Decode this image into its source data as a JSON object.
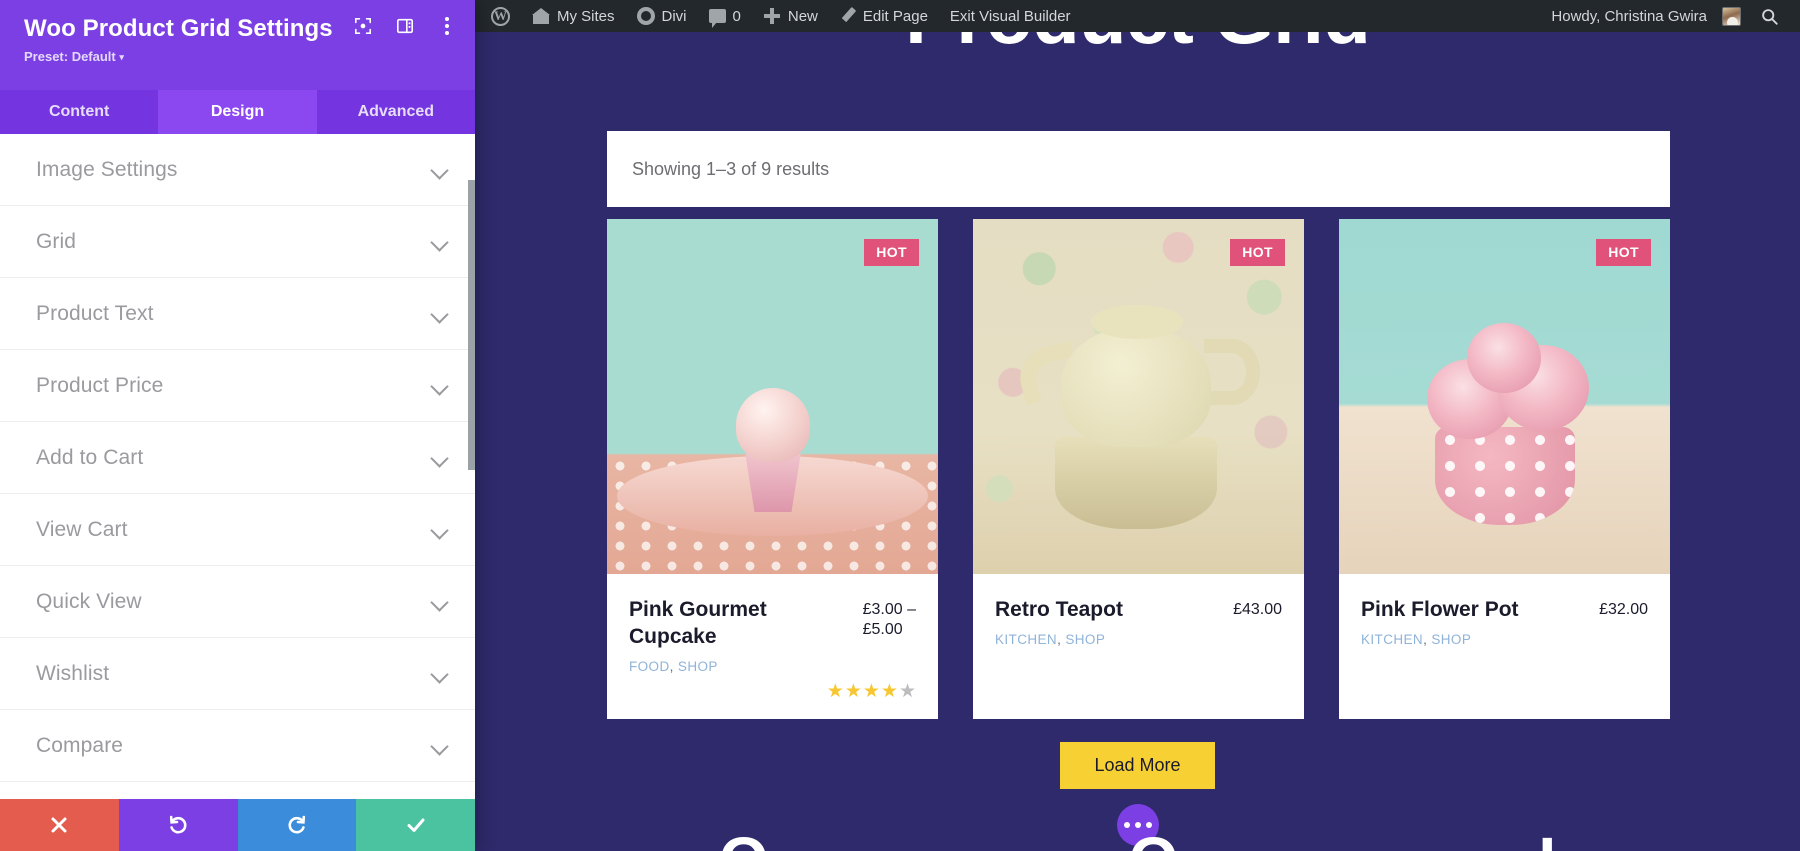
{
  "adminbar": {
    "items": [
      {
        "name": "wp-logo",
        "label": ""
      },
      {
        "name": "my-sites",
        "label": "My Sites"
      },
      {
        "name": "divi",
        "label": "Divi"
      },
      {
        "name": "comments",
        "label": "0"
      },
      {
        "name": "new",
        "label": "New"
      },
      {
        "name": "edit-page",
        "label": "Edit Page"
      },
      {
        "name": "exit-visual-builder",
        "label": "Exit Visual Builder"
      }
    ],
    "howdy": "Howdy, Christina Gwira",
    "search_icon": "search-icon"
  },
  "settings_panel": {
    "title": "Woo Product Grid Settings",
    "preset_label": "Preset: Default",
    "preset_caret": "▾",
    "header_icons": [
      {
        "name": "focus-target-icon"
      },
      {
        "name": "panel-layout-icon"
      },
      {
        "name": "more-options-icon"
      }
    ],
    "tabs": [
      {
        "label": "Content",
        "active": false
      },
      {
        "label": "Design",
        "active": true
      },
      {
        "label": "Advanced",
        "active": false
      }
    ],
    "sections": [
      {
        "label": "Image Settings"
      },
      {
        "label": "Grid"
      },
      {
        "label": "Product Text"
      },
      {
        "label": "Product Price"
      },
      {
        "label": "Add to Cart"
      },
      {
        "label": "View Cart"
      },
      {
        "label": "Quick View"
      },
      {
        "label": "Wishlist"
      },
      {
        "label": "Compare"
      }
    ],
    "footer_buttons": [
      {
        "name": "discard-changes-button",
        "icon": "close-icon",
        "color": "#e35c4d"
      },
      {
        "name": "undo-button",
        "icon": "undo-icon",
        "color": "#7b3fe4"
      },
      {
        "name": "redo-button",
        "icon": "redo-icon",
        "color": "#3b8ddc"
      },
      {
        "name": "save-changes-button",
        "icon": "check-icon",
        "color": "#4bc2a0"
      }
    ]
  },
  "canvas": {
    "page_title": "Product Grid",
    "results_text": "Showing 1–3 of 9 results",
    "background_color": "#2e2a6b",
    "badge_color": "#e0527a",
    "load_more_color": "#f7d033",
    "load_more_label": "Load More",
    "products": [
      {
        "badge": "HOT",
        "title": "Pink Gourmet Cupcake",
        "price": "£3.00 –\n£5.00",
        "categories": [
          "FOOD",
          "SHOP"
        ],
        "rating": 4,
        "max_rating": 5,
        "image": "cupcake-photo"
      },
      {
        "badge": "HOT",
        "title": "Retro Teapot",
        "price": "£43.00",
        "categories": [
          "KITCHEN",
          "SHOP"
        ],
        "rating": 0,
        "max_rating": 5,
        "image": "teapot-photo"
      },
      {
        "badge": "HOT",
        "title": "Pink Flower Pot",
        "price": "£32.00",
        "categories": [
          "KITCHEN",
          "SHOP"
        ],
        "rating": 0,
        "max_rating": 5,
        "image": "flower-pot-photo"
      }
    ]
  }
}
